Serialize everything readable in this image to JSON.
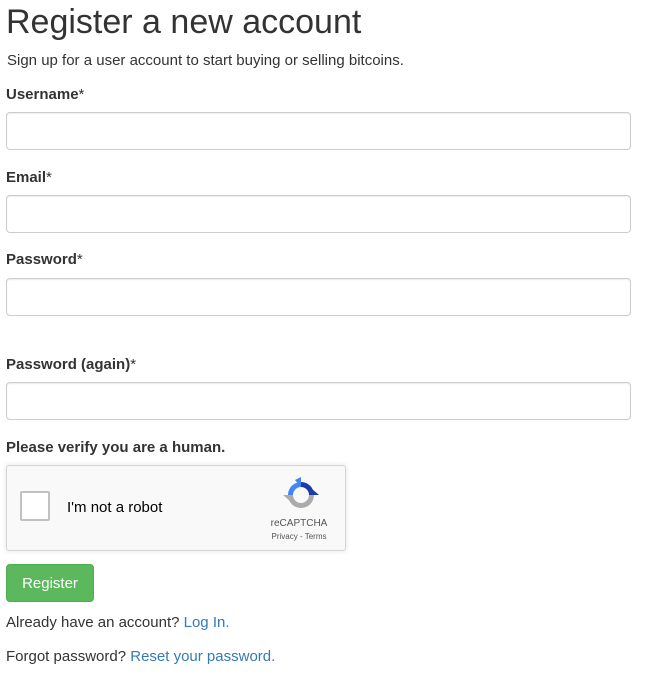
{
  "page": {
    "title": "Register a new account",
    "subtitle": "Sign up for a user account to start buying or selling bitcoins."
  },
  "form": {
    "username_label": "Username",
    "email_label": "Email",
    "password_label": "Password",
    "password_again_label": "Password (again)",
    "required_marker": "*",
    "username_value": "",
    "email_value": "",
    "password_value": "",
    "password_again_value": ""
  },
  "captcha": {
    "prompt": "Please verify you are a human.",
    "checkbox_label": "I'm not a robot",
    "brand": "reCAPTCHA",
    "privacy": "Privacy",
    "separator": "-",
    "terms": "Terms",
    "checked": false
  },
  "actions": {
    "register_label": "Register",
    "login_prompt": "Already have an account?",
    "login_link": "Log In.",
    "forgot_prompt": "Forgot password?",
    "reset_link": "Reset your password."
  },
  "colors": {
    "button_green": "#5cb85c",
    "link_blue": "#337ab7",
    "text": "#333333"
  }
}
